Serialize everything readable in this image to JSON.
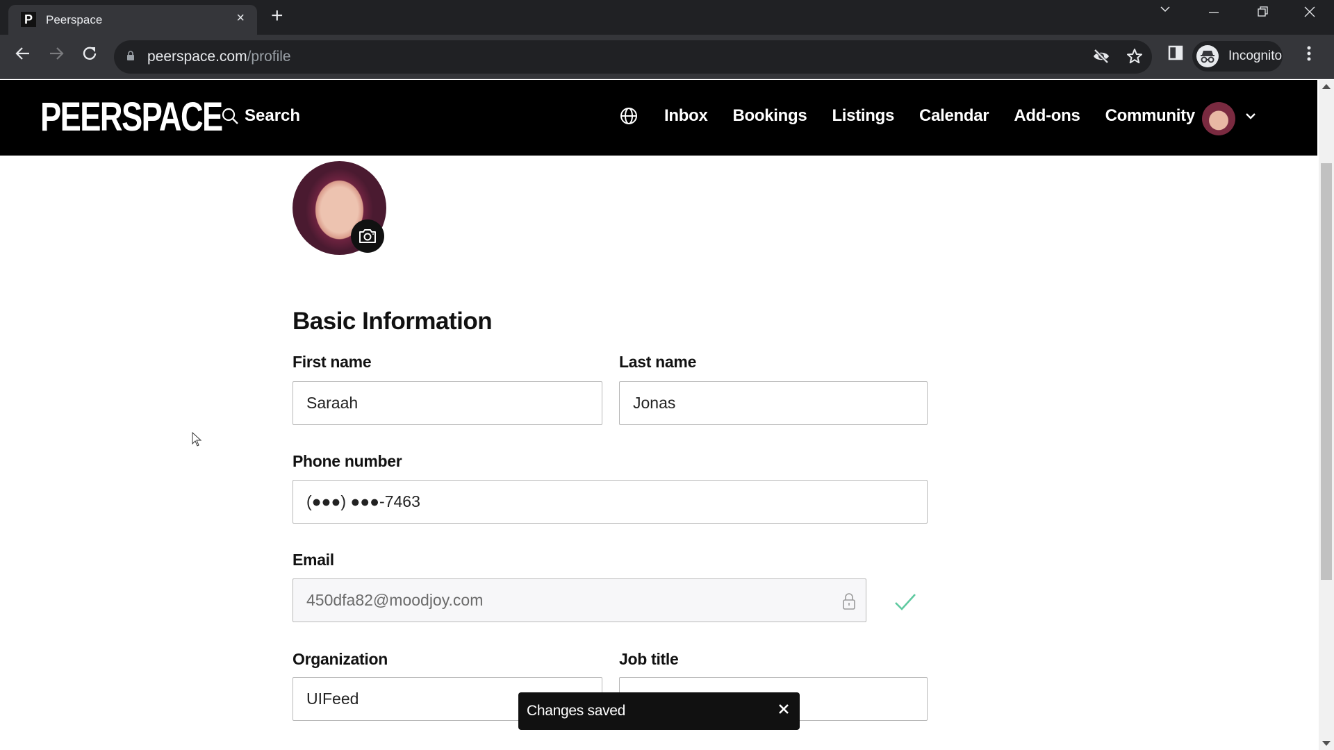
{
  "browser": {
    "tab": {
      "title": "Peerspace",
      "favicon_letter": "P",
      "close": "×"
    },
    "new_tab": "+",
    "window_controls": {
      "tab_search": "⌄",
      "minimize": "—",
      "restore": "❐",
      "close": "✕"
    },
    "url": {
      "domain": "peerspace.com",
      "path": "/profile"
    },
    "profile_label": "Incognito",
    "menu": "⋮"
  },
  "header": {
    "logo": "PEERSPACE",
    "search_label": "Search",
    "nav": [
      {
        "label": "Inbox"
      },
      {
        "label": "Bookings"
      },
      {
        "label": "Listings"
      },
      {
        "label": "Calendar"
      },
      {
        "label": "Add-ons"
      },
      {
        "label": "Community"
      }
    ]
  },
  "profile": {
    "section_title": "Basic Information",
    "fields": {
      "first_name": {
        "label": "First name",
        "value": "Saraah"
      },
      "last_name": {
        "label": "Last name",
        "value": "Jonas"
      },
      "phone": {
        "label": "Phone number",
        "value": "(●●●) ●●●-7463"
      },
      "email": {
        "label": "Email",
        "value": "450dfa82@moodjoy.com",
        "verified": true
      },
      "organization": {
        "label": "Organization",
        "value": "UIFeed"
      },
      "job_title": {
        "label": "Job title",
        "value": ""
      }
    }
  },
  "toast": {
    "message": "Changes saved",
    "close": "✕"
  },
  "colors": {
    "header_bg": "#000000",
    "verified_check": "#5fc9a0",
    "toast_bg": "#111111"
  }
}
